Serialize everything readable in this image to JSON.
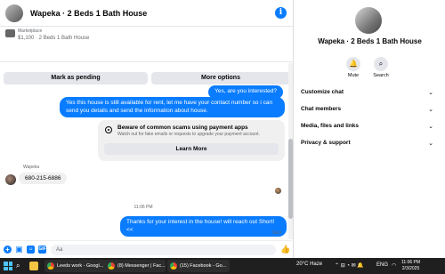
{
  "header": {
    "title": "Wapeka · 2 Beds 1 Bath House"
  },
  "marketplace": {
    "label": "Marketplace",
    "listing": "$1,100 · 2 Beds 1 Bath House",
    "mark_pending": "Mark as pending",
    "more_options": "More options"
  },
  "messages": {
    "out1": "Yes, are you interested?",
    "out2": "Yes this house is still available for rent, let me have your contact number so i can send you details and send the information about house.",
    "scam_card": {
      "title": "Beware of common scams using payment apps",
      "subtitle": "Watch out for fake emails or requests to upgrade your payment account.",
      "button": "Learn More"
    },
    "sender_name": "Wapeka",
    "in1": "680-215-6886",
    "timestamp": "11:06 PM",
    "out3": "Thanks for your interest in the house! will reach out Short! <<",
    "status": "Sent"
  },
  "composer": {
    "placeholder": "Aa"
  },
  "sidebar": {
    "title": "Wapeka · 2 Beds 1 Bath House",
    "mute_label": "Mute",
    "search_label": "Search",
    "items": [
      {
        "label": "Customize chat"
      },
      {
        "label": "Chat members"
      },
      {
        "label": "Media, files and links"
      },
      {
        "label": "Privacy & support"
      }
    ]
  },
  "taskbar": {
    "tabs": [
      {
        "label": "Leeds work - Googl..."
      },
      {
        "label": "(8) Messenger | Fac..."
      },
      {
        "label": "(15) Facebook - Go..."
      }
    ],
    "weather": "20°C  Haze",
    "lang": "ENG",
    "time": "11:06 PM",
    "date": "2/3/2025"
  },
  "colors": {
    "accent": "#0a7cff",
    "taskbar": "#1f1f1f"
  }
}
